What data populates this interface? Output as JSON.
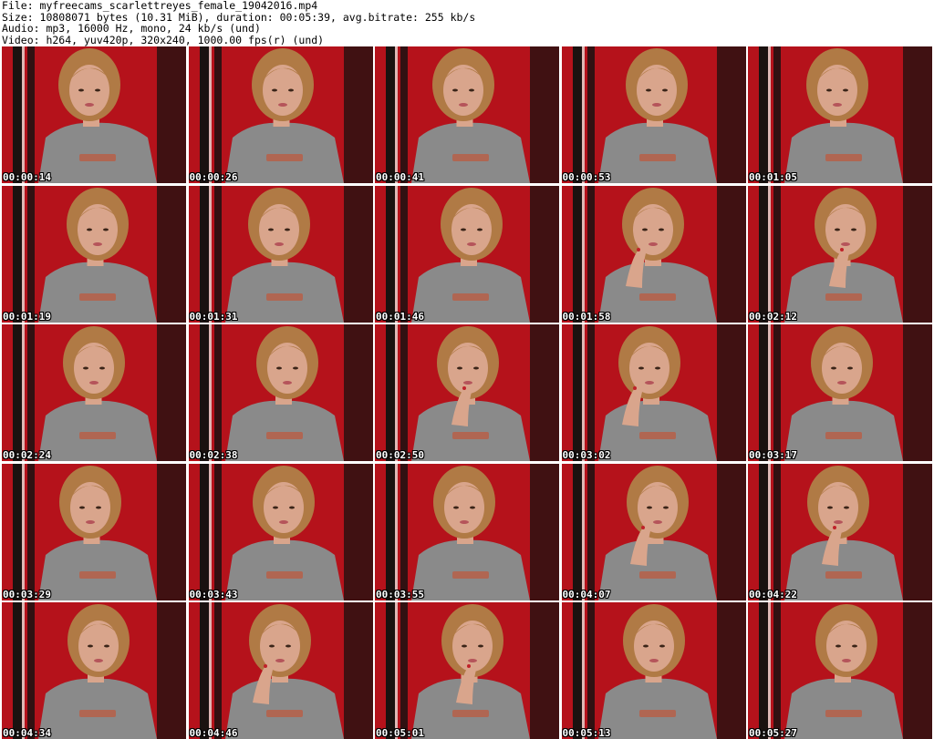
{
  "header": {
    "file_line": "File: myfreecams_scarlettreyes_female_19042016.mp4",
    "size_line": "Size: 10808071 bytes (10.31 MiB), duration: 00:05:39, avg.bitrate: 255 kb/s",
    "audio_line": "Audio: mp3, 16000 Hz, mono, 24 kb/s (und)",
    "video_line": "Video: h264, yuv420p, 320x240, 1000.00 fps(r) (und)"
  },
  "colors": {
    "background_wall": "#b5121b",
    "door_dark": "#1a1210",
    "shirt": "#8a8a8a",
    "skin": "#d9a58c",
    "hair": "#b07a45",
    "timestamp_text": "#ffffff"
  },
  "frames": [
    {
      "timestamp": "00:00:14",
      "hand": false
    },
    {
      "timestamp": "00:00:26",
      "hand": false
    },
    {
      "timestamp": "00:00:41",
      "hand": false
    },
    {
      "timestamp": "00:00:53",
      "hand": false
    },
    {
      "timestamp": "00:01:05",
      "hand": false
    },
    {
      "timestamp": "00:01:19",
      "hand": false
    },
    {
      "timestamp": "00:01:31",
      "hand": false
    },
    {
      "timestamp": "00:01:46",
      "hand": false
    },
    {
      "timestamp": "00:01:58",
      "hand": true
    },
    {
      "timestamp": "00:02:12",
      "hand": true
    },
    {
      "timestamp": "00:02:24",
      "hand": false
    },
    {
      "timestamp": "00:02:38",
      "hand": false
    },
    {
      "timestamp": "00:02:50",
      "hand": true
    },
    {
      "timestamp": "00:03:02",
      "hand": true
    },
    {
      "timestamp": "00:03:17",
      "hand": false
    },
    {
      "timestamp": "00:03:29",
      "hand": false
    },
    {
      "timestamp": "00:03:43",
      "hand": false
    },
    {
      "timestamp": "00:03:55",
      "hand": false
    },
    {
      "timestamp": "00:04:07",
      "hand": true
    },
    {
      "timestamp": "00:04:22",
      "hand": true
    },
    {
      "timestamp": "00:04:34",
      "hand": false
    },
    {
      "timestamp": "00:04:46",
      "hand": true
    },
    {
      "timestamp": "00:05:01",
      "hand": true
    },
    {
      "timestamp": "00:05:13",
      "hand": false
    },
    {
      "timestamp": "00:05:27",
      "hand": false
    }
  ]
}
